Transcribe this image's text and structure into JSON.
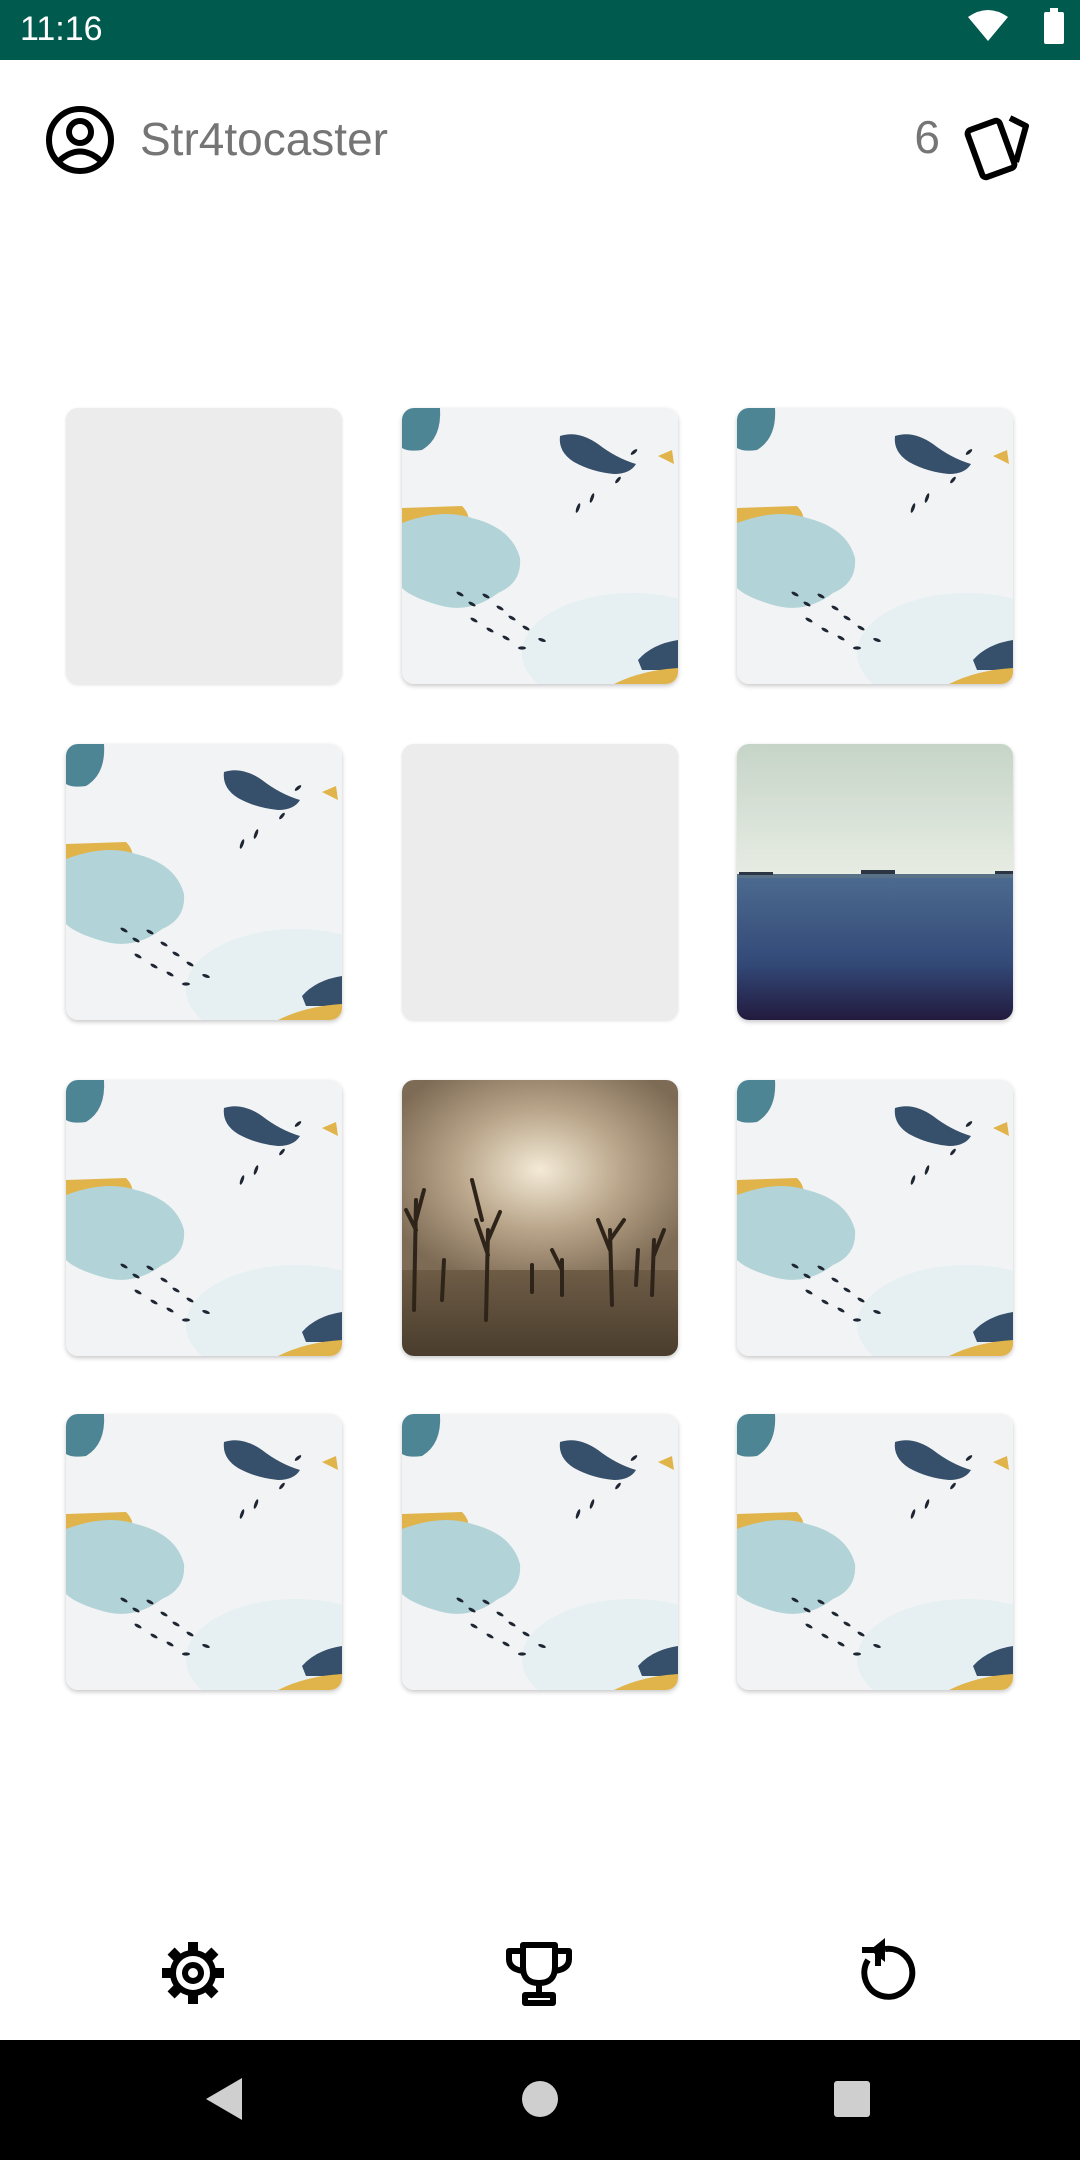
{
  "status_bar": {
    "time": "11:16",
    "icons": [
      "wifi-icon",
      "battery-icon"
    ]
  },
  "header": {
    "username": "Str4tocaster",
    "moves": "6",
    "user_icon": "account-circle-icon",
    "moves_icon": "cards-icon"
  },
  "board": {
    "rows": 4,
    "columns": 3,
    "cards": [
      {
        "state": "matched",
        "face": "empty"
      },
      {
        "state": "face-down",
        "face": "back-pattern"
      },
      {
        "state": "face-down",
        "face": "back-pattern"
      },
      {
        "state": "face-down",
        "face": "back-pattern"
      },
      {
        "state": "matched",
        "face": "empty"
      },
      {
        "state": "face-up",
        "face": "sea-photo"
      },
      {
        "state": "face-down",
        "face": "back-pattern"
      },
      {
        "state": "face-up",
        "face": "dead-forest-photo"
      },
      {
        "state": "face-down",
        "face": "back-pattern"
      },
      {
        "state": "face-down",
        "face": "back-pattern"
      },
      {
        "state": "face-down",
        "face": "back-pattern"
      },
      {
        "state": "face-down",
        "face": "back-pattern"
      }
    ]
  },
  "bottom_bar": {
    "buttons": [
      "settings-icon",
      "trophy-icon",
      "restart-icon"
    ]
  },
  "nav_bar": {
    "buttons": [
      "back-icon",
      "home-icon",
      "recents-icon"
    ]
  },
  "colors": {
    "status_bar": "#005a4e",
    "text_secondary": "#757575",
    "card_removed": "#ececec"
  }
}
